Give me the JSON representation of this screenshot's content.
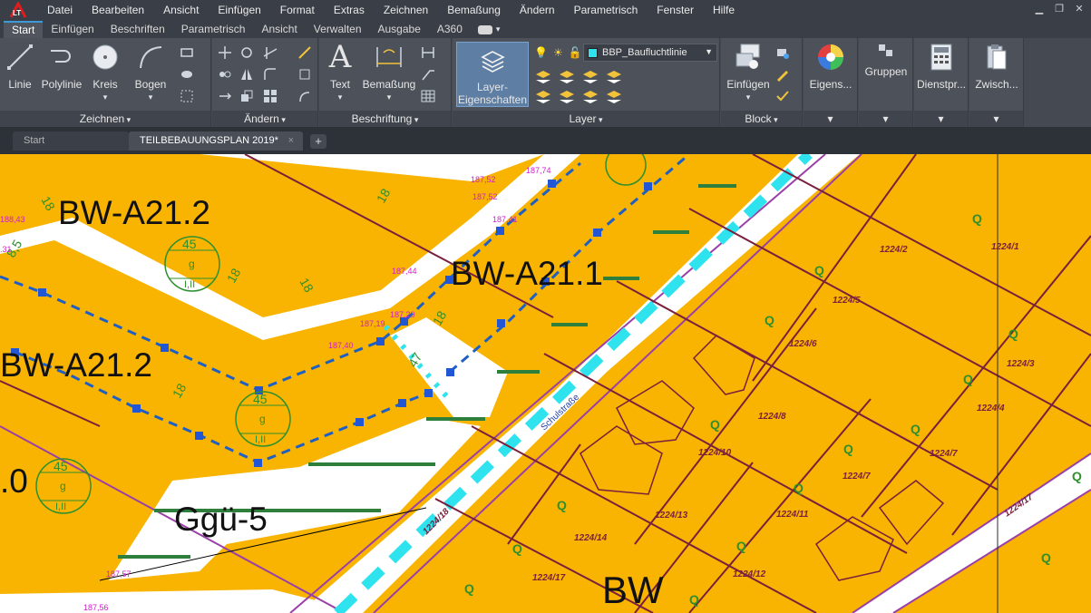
{
  "app": {
    "logo_text": "LT"
  },
  "menu": [
    "Datei",
    "Bearbeiten",
    "Ansicht",
    "Einfügen",
    "Format",
    "Extras",
    "Zeichnen",
    "Bemaßung",
    "Ändern",
    "Parametrisch",
    "Fenster",
    "Hilfe"
  ],
  "ribbon_tabs": [
    "Start",
    "Einfügen",
    "Beschriften",
    "Parametrisch",
    "Ansicht",
    "Verwalten",
    "Ausgabe",
    "A360"
  ],
  "active_ribbon_tab": "Start",
  "panels": {
    "zeichnen": {
      "title": "Zeichnen",
      "buttons": [
        "Linie",
        "Polylinie",
        "Kreis",
        "Bogen"
      ]
    },
    "aendern": {
      "title": "Ändern"
    },
    "beschriftung": {
      "title": "Beschriftung",
      "text": "Text",
      "bemassung": "Bemaßung"
    },
    "layer": {
      "title": "Layer",
      "btn_line1": "Layer-",
      "btn_line2": "Eigenschaften",
      "current_layer": "BBP_Baufluchtlinie",
      "current_layer_color": "#2fe3ee"
    },
    "block": {
      "title": "Block",
      "einfuegen": "Einfügen"
    },
    "eigenschaften": {
      "label": "Eigens..."
    },
    "gruppen": {
      "label": "Gruppen"
    },
    "dienstprogramme": {
      "label": "Dienstpr..."
    },
    "zwischenablage": {
      "label": "Zwisch..."
    }
  },
  "file_tabs": {
    "start": "Start",
    "document": "TEILBEBAUUNGSPLAN 2019*",
    "close": "×",
    "add": "+"
  },
  "drawing": {
    "zone_labels": [
      "BW-A21.2",
      "BW-A21.1",
      "BW-A21.2",
      ".0",
      "Ggü-5",
      "BW"
    ],
    "elevations": [
      "188,43",
      ".31",
      "187,52",
      "187,52",
      "187,74",
      "187,41",
      "187,44",
      "187,19",
      "187,20",
      "187,40",
      "187,57",
      "187,56"
    ],
    "numbers": [
      "18",
      "18",
      "18",
      "18",
      "18",
      "18",
      "8,5",
      "47"
    ],
    "circle_sign": {
      "top": "45",
      "middle": "g",
      "bottom": "I,II"
    },
    "parcels": [
      "1224/2",
      "1224/1",
      "1224/5",
      "1224/6",
      "1224/7",
      "1224/3",
      "1224/4",
      "1224/10",
      "1224/8",
      "1224/7",
      "1224/13",
      "1224/11",
      "1224/14",
      "1224/17",
      "1224/12",
      "1224/18",
      "1224/17"
    ],
    "street_name": "Schulstraße",
    "vegetation_symbol": "Q"
  },
  "colors": {
    "building_zone": "#f8b400",
    "road": "#ffffff",
    "parcel_line": "#7a1f3c",
    "boundary_line": "#9b3fa8",
    "baufluchtlinie": "#2fe3ee",
    "baugrenze": "#1f5fc4",
    "marker": "#2156d4",
    "vegetation": "#2f8f2f",
    "elevation_text": "#d11ec8"
  }
}
